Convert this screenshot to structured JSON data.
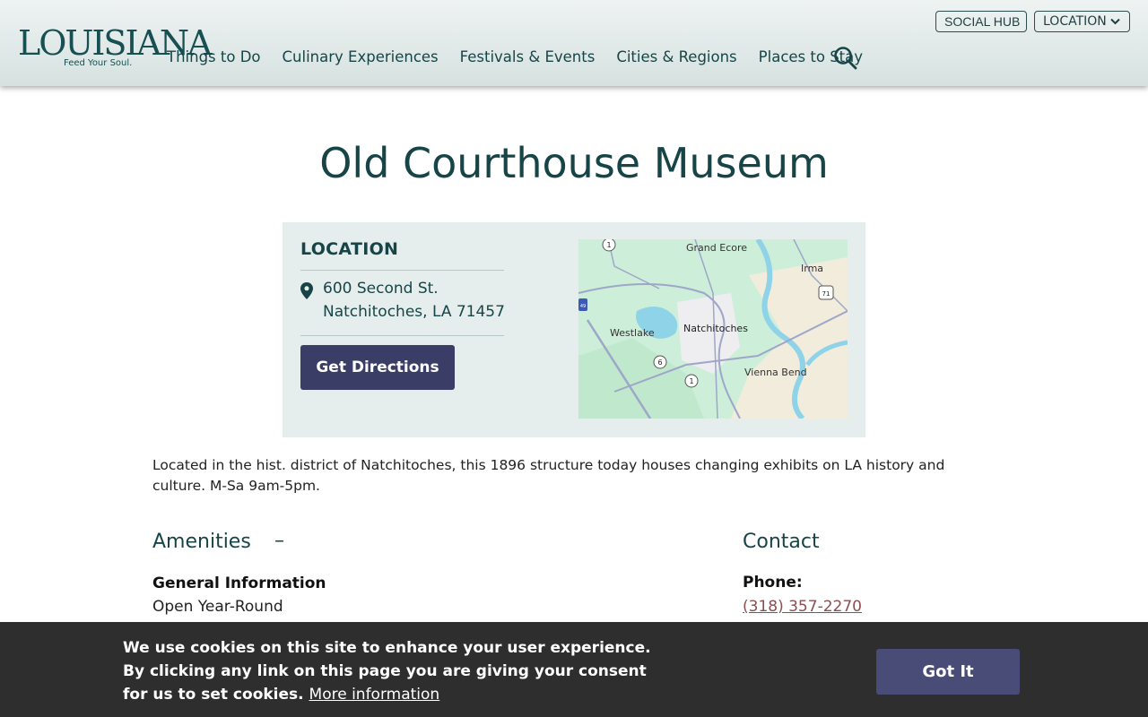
{
  "header": {
    "logo_text": "LOUISIANA",
    "logo_tagline": "Feed Your Soul.",
    "nav": [
      {
        "label": "Things to Do"
      },
      {
        "label": "Culinary Experiences"
      },
      {
        "label": "Festivals & Events"
      },
      {
        "label": "Cities & Regions"
      },
      {
        "label": "Places to Stay"
      }
    ],
    "social_hub_label": "SOCIAL HUB",
    "location_label": "LOCATION"
  },
  "page": {
    "title": "Old Courthouse Museum"
  },
  "location_card": {
    "heading": "LOCATION",
    "address_line1": "600 Second St.",
    "address_line2": "Natchitoches, LA 71457",
    "directions_label": "Get Directions",
    "map": {
      "labels": [
        "Grand Ecore",
        "Irma",
        "Westlake",
        "Natchitoches",
        "Vienna Bend"
      ],
      "route_shields": [
        "1",
        "71",
        "6",
        "1",
        "49"
      ]
    }
  },
  "description": "Located in the hist. district of Natchitoches, this 1896 structure today houses changing exhibits on LA history and culture. M-Sa 9am-5pm.",
  "amenities": {
    "heading": "Amenities",
    "toggle_symbol": "–",
    "section_label": "General Information",
    "items": [
      "Open Year-Round"
    ]
  },
  "contact": {
    "heading": "Contact",
    "phone_label": "Phone:",
    "phone": "(318) 357-2270"
  },
  "cookie_banner": {
    "text": "We use cookies on this site to enhance your user experience. By clicking any link on this page you are giving your consent for us to set cookies.",
    "more_link": "More information",
    "button_label": "Got It"
  },
  "colors": {
    "brand_teal": "#174547",
    "button_navy": "#3a3d66",
    "card_bg": "#e5eeed",
    "cookie_bg": "#2e2e2e"
  }
}
